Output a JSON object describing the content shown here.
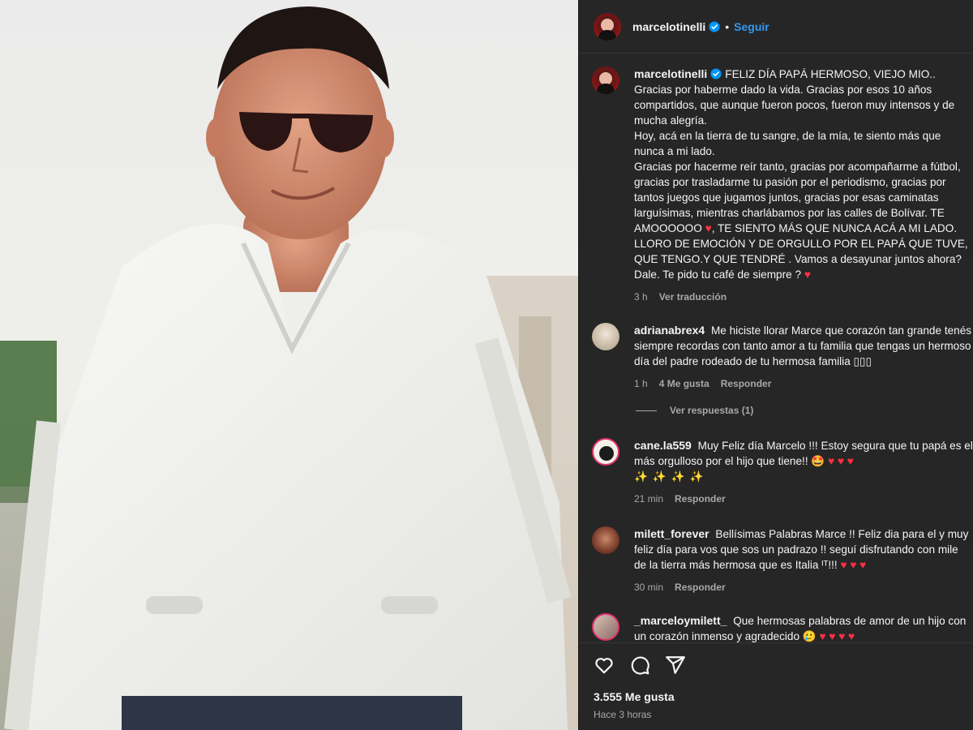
{
  "header": {
    "username": "marcelotinelli",
    "dot": "•",
    "follow_label": "Seguir"
  },
  "caption": {
    "username": "marcelotinelli",
    "para1": "FELIZ DÍA PAPÁ HERMOSO, VIEJO MIO.. Gracias por haberme dado la vida. Gracias por esos 10 años compartidos, que aunque fueron pocos, fueron muy intensos y de mucha alegría.",
    "para2": "Hoy, acá en la tierra de tu sangre, de la mía, te siento más que nunca a mi lado.",
    "para3a": "Gracias por hacerme reír tanto, gracias por acompañarme a fútbol, gracias por trasladarme tu pasión por el periodismo, gracias por tantos juegos que jugamos juntos, gracias por esas caminatas larguísimas, mientras charlábamos por las calles de Bolívar. TE AMOOOOOO ",
    "para3b": ", TE SIENTO MÁS QUE NUNCA ACÁ A MI LADO. LLORO DE EMOCIÓN Y DE ORGULLO POR EL PAPÁ QUE TUVE, QUE TENGO.Y QUE TENDRÉ . Vamos a desayunar juntos ahora? Dale. Te pido tu café de siempre ? ",
    "heart": "♥",
    "time": "3 h",
    "translate_label": "Ver traducción"
  },
  "comments": [
    {
      "username": "adrianabrex4",
      "text": "Me hiciste llorar Marce que corazón tan grande tenés siempre recordas con tanto amor a tu familia que tengas un hermoso día del padre rodeado de tu hermosa familia ▯▯▯",
      "time": "1 h",
      "likes": "4 Me gusta",
      "reply_label": "Responder"
    },
    {
      "username": "cane.la559",
      "text": "Muy Feliz día Marcelo !!! Estoy segura que tu papá es el más orgulloso por el hijo que tiene!! 🤩 ",
      "hearts": "♥ ♥ ♥",
      "sparkles": "✨✨✨✨",
      "time": "21 min",
      "reply_label": "Responder"
    },
    {
      "username": "milett_forever",
      "text": "Bellísimas Palabras Marce !! Feliz dia para el y muy feliz día para vos que sos un padrazo !! seguí disfrutando con mile de la tierra más hermosa que es Italia ᴵᵀ!!! ",
      "hearts": "♥ ♥ ♥",
      "time": "30 min",
      "reply_label": "Responder"
    },
    {
      "username": "_marceloymilett_",
      "text": "Que hermosas palabras de amor de un hijo con un corazón inmenso y agradecido 🥲 ",
      "hearts": "♥ ♥ ♥ ♥"
    }
  ],
  "view_replies_label": "Ver respuestas (1)",
  "footer": {
    "likes": "3.555 Me gusta",
    "time": "Hace 3 horas"
  },
  "icons": [
    "verified-badge-icon",
    "heart-icon",
    "comment-icon",
    "share-icon"
  ],
  "colors": {
    "panel_bg": "#262626",
    "link_blue": "#3797f0",
    "verified_blue": "#0095f6",
    "heart_red": "#ff3040",
    "muted_text": "#a8a8a8"
  }
}
